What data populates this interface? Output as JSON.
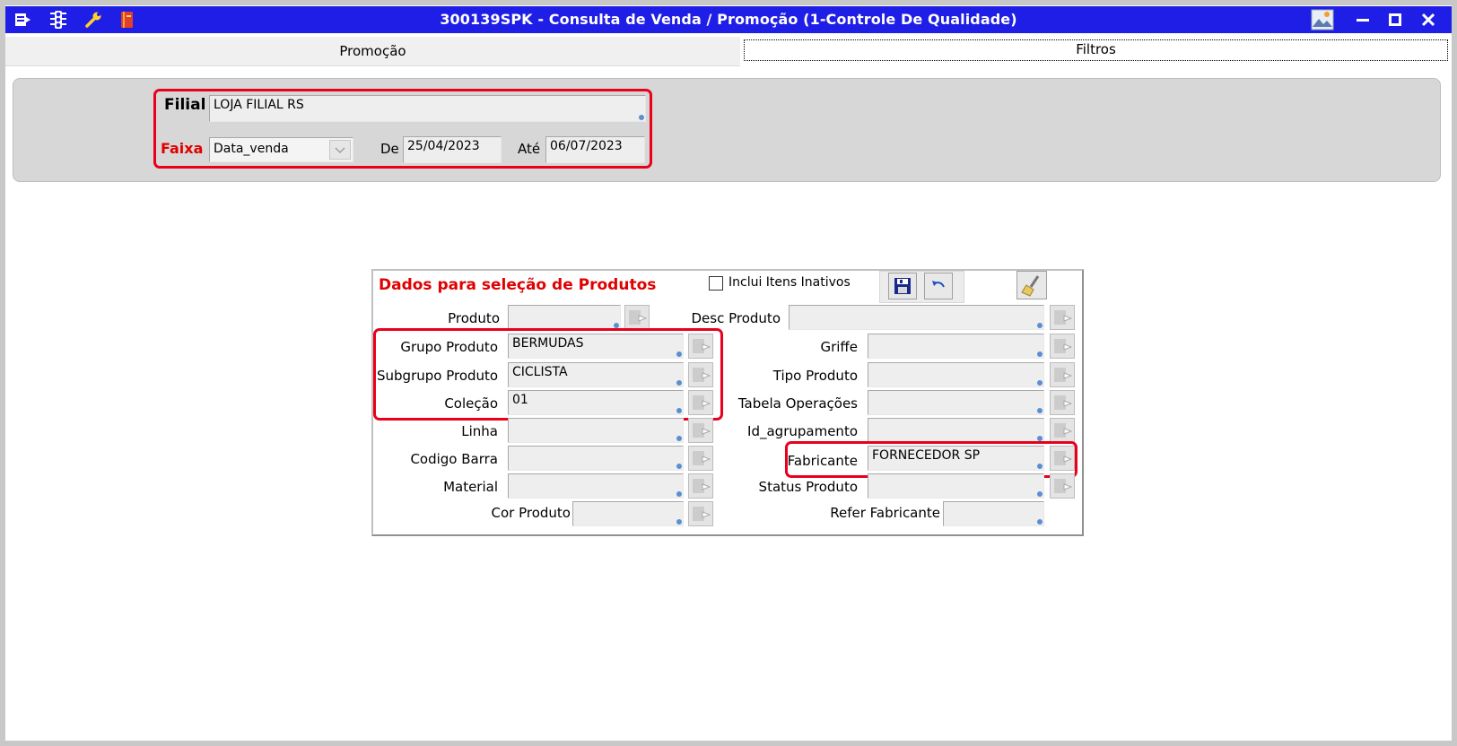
{
  "window": {
    "title": "300139SPK - Consulta de Venda / Promoção (1-Controle De Qualidade)"
  },
  "tabs": [
    {
      "label": "Promoção"
    },
    {
      "label": "Filtros"
    }
  ],
  "filters": {
    "filial_label": "Filial",
    "filial_value": "LOJA FILIAL RS",
    "faixa_label": "Faixa",
    "faixa_value": "Data_venda",
    "de_label": "De",
    "de_value": "25/04/2023",
    "ate_label": "Até",
    "ate_value": "06/07/2023"
  },
  "products": {
    "title": "Dados para seleção de Produtos",
    "inclui_inativos_label": "Inclui Itens Inativos",
    "inclui_inativos_checked": false,
    "left": [
      {
        "label": "Produto",
        "value": ""
      },
      {
        "label": "Grupo Produto",
        "value": "BERMUDAS"
      },
      {
        "label": "Subgrupo Produto",
        "value": "CICLISTA"
      },
      {
        "label": "Coleção",
        "value": "01"
      },
      {
        "label": "Linha",
        "value": ""
      },
      {
        "label": "Codigo Barra",
        "value": ""
      },
      {
        "label": "Material",
        "value": ""
      },
      {
        "label": "Cor Produto",
        "value": ""
      }
    ],
    "right": [
      {
        "label": "Desc Produto",
        "value": ""
      },
      {
        "label": "Griffe",
        "value": ""
      },
      {
        "label": "Tipo Produto",
        "value": ""
      },
      {
        "label": "Tabela Operações",
        "value": ""
      },
      {
        "label": "Id_agrupamento",
        "value": ""
      },
      {
        "label": "Fabricante",
        "value": "FORNECEDOR SP"
      },
      {
        "label": "Status Produto",
        "value": ""
      },
      {
        "label": "Refer Fabricante",
        "value": ""
      }
    ]
  },
  "colors": {
    "titlebar": "#1e1ee6",
    "highlight": "#e8001c",
    "section_title": "#e00000"
  }
}
